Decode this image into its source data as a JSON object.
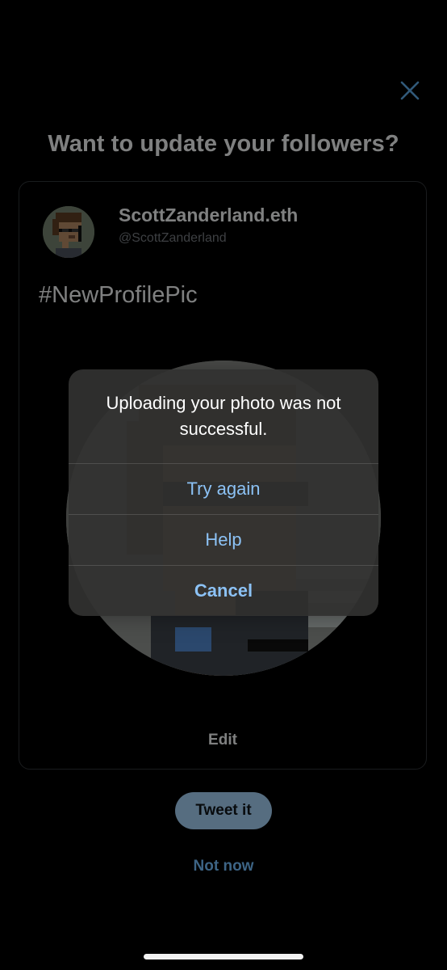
{
  "header": {
    "close_icon": "close-icon",
    "title": "Want to update your followers?"
  },
  "preview": {
    "display_name": "ScottZanderland.eth",
    "handle": "@ScottZanderland",
    "text": "#NewProfilePic",
    "edit_label": "Edit"
  },
  "actions": {
    "tweet_label": "Tweet it",
    "not_now_label": "Not now"
  },
  "alert": {
    "message": "Uploading your photo was not successful.",
    "buttons": [
      {
        "label": "Try again"
      },
      {
        "label": "Help"
      },
      {
        "label": "Cancel"
      }
    ]
  },
  "colors": {
    "background": "#000000",
    "accent": "#6fb7f3",
    "tweet_button": "#9dc7ea",
    "alert_action": "#8cc2f5"
  }
}
